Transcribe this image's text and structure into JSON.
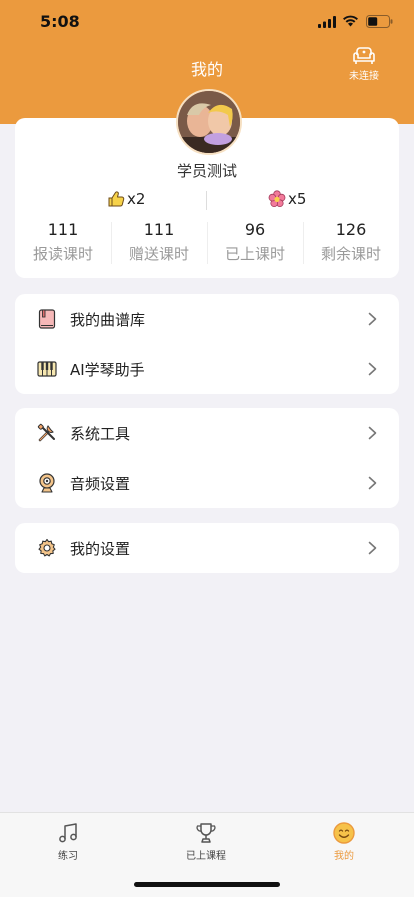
{
  "status_bar": {
    "time": "5:08"
  },
  "header": {
    "title": "我的",
    "device_label": "未连接"
  },
  "profile": {
    "name": "学员测试",
    "likes": "x2",
    "flowers": "x5",
    "stats": [
      {
        "value": "111",
        "label": "报读课时"
      },
      {
        "value": "111",
        "label": "赠送课时"
      },
      {
        "value": "96",
        "label": "已上课时"
      },
      {
        "value": "126",
        "label": "剩余课时"
      }
    ]
  },
  "menu_groups": [
    {
      "items": [
        {
          "label": "我的曲谱库",
          "icon": "songbook-icon"
        },
        {
          "label": "AI学琴助手",
          "icon": "piano-keys-icon"
        }
      ]
    },
    {
      "items": [
        {
          "label": "系统工具",
          "icon": "tools-icon"
        },
        {
          "label": "音频设置",
          "icon": "webcam-icon"
        }
      ]
    },
    {
      "items": [
        {
          "label": "我的设置",
          "icon": "gear-icon"
        }
      ]
    }
  ],
  "tabbar": {
    "active": "我的",
    "tabs": [
      {
        "label": "练习",
        "icon": "music-note-icon"
      },
      {
        "label": "已上课程",
        "icon": "trophy-icon"
      },
      {
        "label": "我的",
        "icon": "smiley-icon"
      }
    ]
  },
  "colors": {
    "accent": "#eb9a3e",
    "background": "#f2f1f6"
  }
}
